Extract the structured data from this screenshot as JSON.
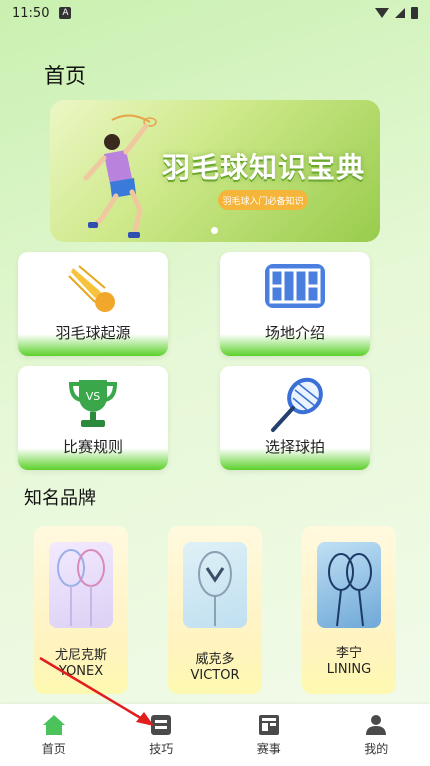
{
  "status": {
    "time": "11:50",
    "notif": "A"
  },
  "page": {
    "title": "首页"
  },
  "banner": {
    "title": "羽毛球知识宝典",
    "tag": "羽毛球入门必备知识"
  },
  "cards": [
    {
      "label": "羽毛球起源",
      "icon": "shuttlecock-icon"
    },
    {
      "label": "场地介绍",
      "icon": "court-icon"
    },
    {
      "label": "比赛规则",
      "icon": "trophy-icon"
    },
    {
      "label": "选择球拍",
      "icon": "racket-icon"
    }
  ],
  "brands": {
    "title": "知名品牌",
    "items": [
      {
        "cn": "尤尼克斯",
        "en": "YONEX"
      },
      {
        "cn": "威克多",
        "en": "VICTOR"
      },
      {
        "cn": "李宁",
        "en": "LINING"
      }
    ]
  },
  "tabbar": {
    "items": [
      {
        "label": "首页",
        "icon": "home-icon",
        "color": "#4cc35a"
      },
      {
        "label": "技巧",
        "icon": "tips-icon",
        "color": "#4a4a4a"
      },
      {
        "label": "赛事",
        "icon": "events-icon",
        "color": "#4a4a4a"
      },
      {
        "label": "我的",
        "icon": "profile-icon",
        "color": "#4a4a4a"
      }
    ]
  },
  "colors": {
    "accent": "#5bd12a",
    "banner_tag": "#f5b43a"
  }
}
